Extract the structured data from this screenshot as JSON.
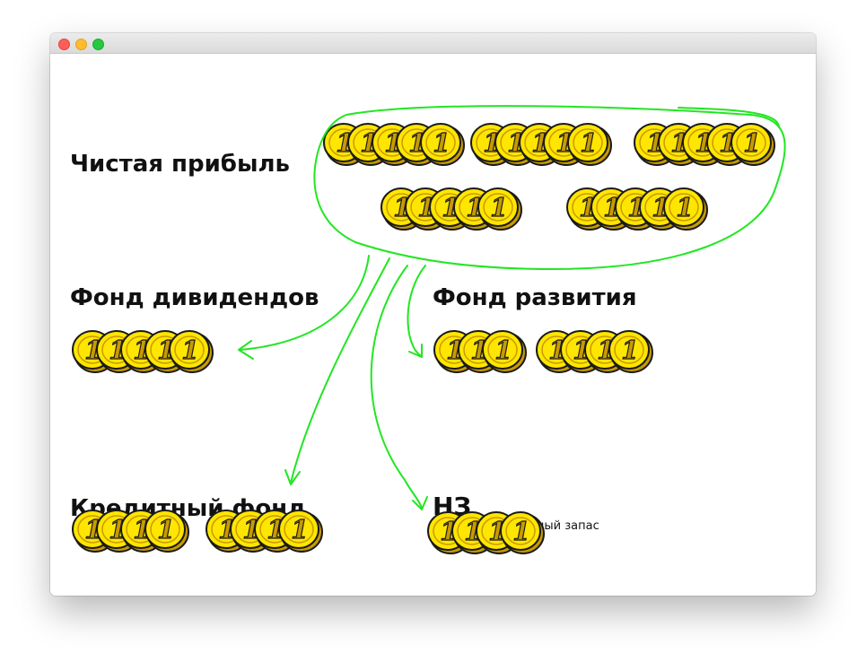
{
  "window": {
    "close_button": "close",
    "minimize_button": "minimize",
    "zoom_button": "zoom"
  },
  "colors": {
    "coin_fill": "#ffe600",
    "coin_edge": "#c99a00",
    "coin_outline": "#1a1a1a",
    "arrow": "#22e622",
    "text": "#111111"
  },
  "coin_symbol": "1",
  "groups": {
    "net_profit": {
      "label": "Чистая прибыль",
      "coin_groups": [
        5,
        5,
        5,
        5,
        5
      ]
    },
    "dividend_fund": {
      "label": "Фонд дивидендов",
      "coin_groups": [
        5
      ]
    },
    "development_fund": {
      "label": "Фонд развития",
      "coin_groups": [
        3,
        4
      ]
    },
    "credit_fund": {
      "label": "Кредитный фонд",
      "coin_groups": [
        4,
        4
      ]
    },
    "reserve_fund": {
      "label": "НЗ",
      "sublabel": "– неприкосновенный запас",
      "coin_groups": [
        4
      ]
    }
  }
}
